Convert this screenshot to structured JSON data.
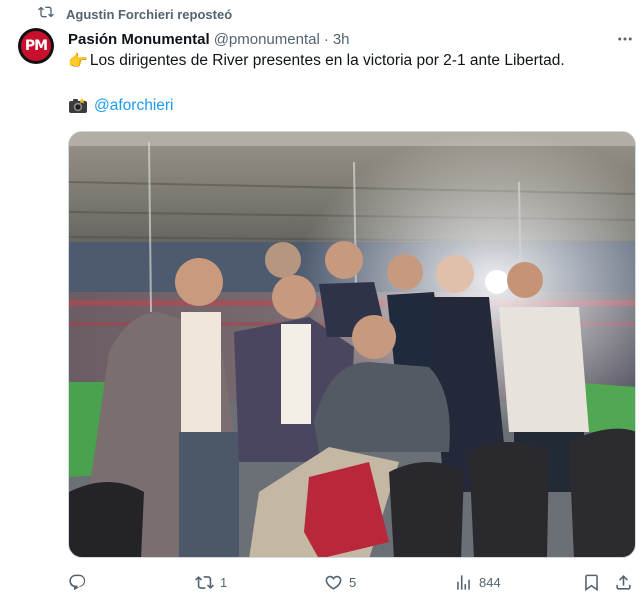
{
  "repost": {
    "icon": "repost-icon",
    "text": "Agustin Forchieri reposteó"
  },
  "tweet": {
    "avatar": {
      "text": "PM",
      "color": "#c8102e"
    },
    "author_name": "Pasión Monumental",
    "handle": "@pmonumental",
    "separator": "·",
    "time": "3h",
    "text_emoji": "👉",
    "text": "Los dirigentes de River presentes en la victoria por 2-1 ante Libertad.",
    "camera_icon": "camera-icon",
    "mention": "@aforchieri"
  },
  "actions": {
    "reply": {
      "icon": "reply-icon",
      "count": ""
    },
    "repost": {
      "icon": "repost-icon",
      "count": "1",
      "color": "#00ba7c"
    },
    "like": {
      "icon": "heart-icon",
      "count": "5"
    },
    "views": {
      "icon": "views-icon",
      "count": "844"
    },
    "bookmark": {
      "icon": "bookmark-icon"
    },
    "share": {
      "icon": "share-icon"
    }
  },
  "colors": {
    "text": "#0f1419",
    "muted": "#536471",
    "link": "#1d9bf0",
    "border": "#cfd9de"
  }
}
